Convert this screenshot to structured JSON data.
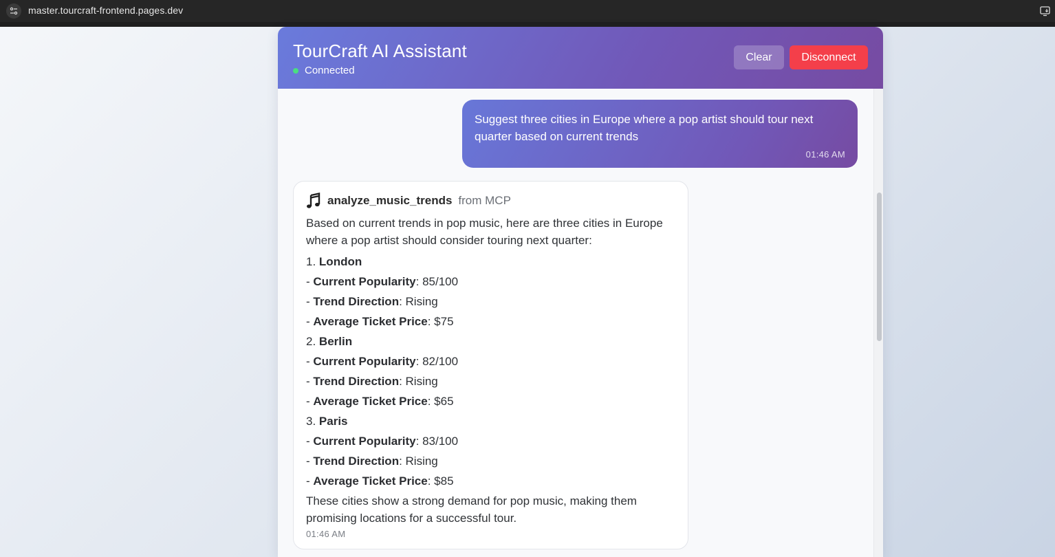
{
  "browser": {
    "url": "master.tourcraft-frontend.pages.dev",
    "site_icon": "tune-icon",
    "install_icon": "install-app-icon"
  },
  "header": {
    "title": "TourCraft AI Assistant",
    "status": "Connected",
    "status_color": "#4ade80",
    "clear_label": "Clear",
    "disconnect_label": "Disconnect"
  },
  "colors": {
    "header_gradient_start": "#6a7bdc",
    "header_gradient_end": "#764ba2",
    "disconnect": "#f43f4a"
  },
  "messages": {
    "user": {
      "text": "Suggest three cities in Europe where a pop artist should tour next quarter based on current trends",
      "time": "01:46 AM"
    },
    "assistant": {
      "tool_icon": "music-note-icon",
      "tool_name": "analyze_music_trends",
      "tool_source": "from MCP",
      "intro": "Based on current trends in pop music, here are three cities in Europe where a pop artist should consider touring next quarter:",
      "labels": {
        "popularity": "Current Popularity",
        "trend": "Trend Direction",
        "price": "Average Ticket Price"
      },
      "cities": [
        {
          "num": "1.",
          "name": "London",
          "popularity": ": 85/100",
          "trend": ": Rising",
          "price": ": $75"
        },
        {
          "num": "2.",
          "name": "Berlin",
          "popularity": ": 82/100",
          "trend": ": Rising",
          "price": ": $65"
        },
        {
          "num": "3.",
          "name": "Paris",
          "popularity": ": 83/100",
          "trend": ": Rising",
          "price": ": $85"
        }
      ],
      "outro": "These cities show a strong demand for pop music, making them promising locations for a successful tour.",
      "time": "01:46 AM"
    }
  }
}
